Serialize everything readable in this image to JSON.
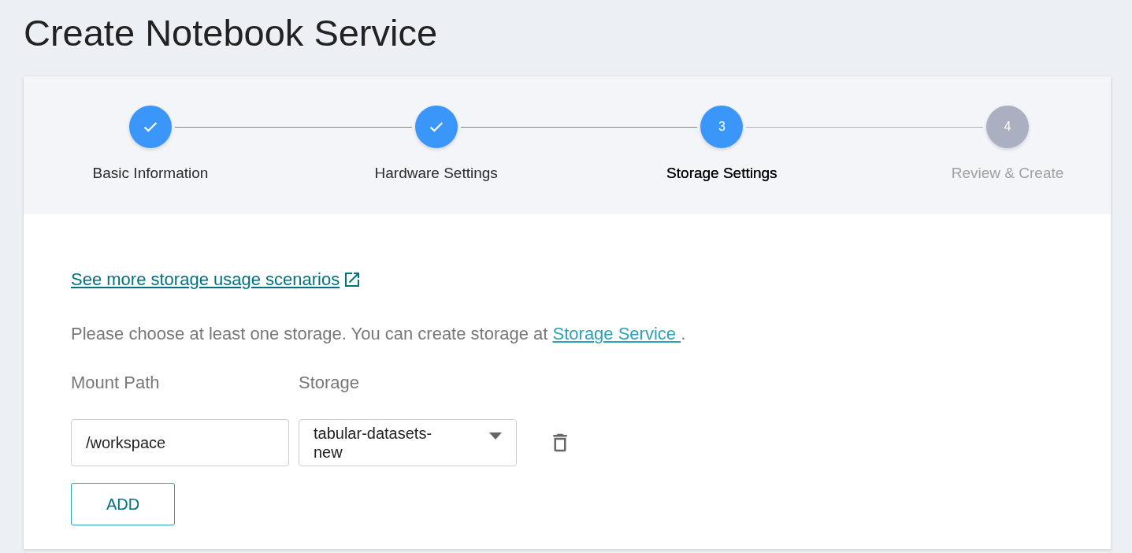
{
  "title": "Create Notebook Service",
  "steps": [
    {
      "label": "Basic Information",
      "completed": true,
      "selected": false
    },
    {
      "label": "Hardware Settings",
      "completed": true,
      "selected": false
    },
    {
      "label": "Storage Settings",
      "completed": false,
      "selected": true,
      "number": "3"
    },
    {
      "label": "Review & Create",
      "completed": false,
      "selected": false,
      "number": "4"
    }
  ],
  "scenarios_link": "See more storage usage scenarios ",
  "intro": {
    "text": "Please choose at least one storage. You can create storage at ",
    "link": "Storage Service ",
    "end": "."
  },
  "mount_labels": {
    "path": "Mount Path",
    "storage": "Storage"
  },
  "mounts": [
    {
      "path": "/workspace",
      "storage": "tabular-datasets-new"
    }
  ],
  "add_button": "ADD"
}
